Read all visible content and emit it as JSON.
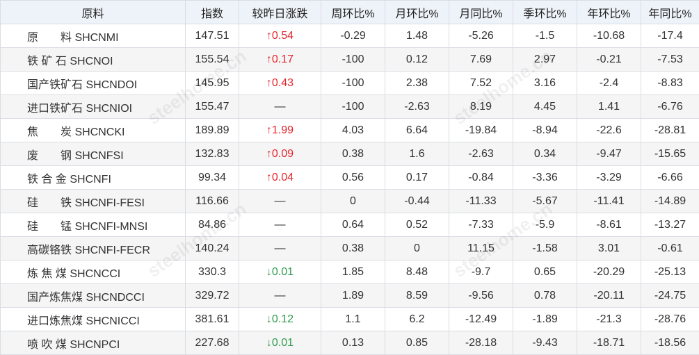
{
  "table": {
    "headers": [
      "原料",
      "指数",
      "较昨日涨跌",
      "周环比%",
      "月环比%",
      "月同比%",
      "季环比%",
      "年环比%",
      "年同比%"
    ],
    "rows": [
      {
        "name": "原　　料 SHCNMI",
        "index": "147.51",
        "change": "↑0.54",
        "dir": "up",
        "wow": "-0.29",
        "mom": "1.48",
        "yoy_m": "-5.26",
        "qoq": "-1.5",
        "y_env": "-10.68",
        "yoy": "-17.4"
      },
      {
        "name": "铁 矿 石 SHCNOI",
        "index": "155.54",
        "change": "↑0.17",
        "dir": "up",
        "wow": "-100",
        "mom": "0.12",
        "yoy_m": "7.69",
        "qoq": "2.97",
        "y_env": "-0.21",
        "yoy": "-7.53"
      },
      {
        "name": "国产铁矿石 SHCNDOI",
        "index": "145.95",
        "change": "↑0.43",
        "dir": "up",
        "wow": "-100",
        "mom": "2.38",
        "yoy_m": "7.52",
        "qoq": "3.16",
        "y_env": "-2.4",
        "yoy": "-8.83"
      },
      {
        "name": "进口铁矿石 SHCNIOI",
        "index": "155.47",
        "change": "—",
        "dir": "flat",
        "wow": "-100",
        "mom": "-2.63",
        "yoy_m": "8.19",
        "qoq": "4.45",
        "y_env": "1.41",
        "yoy": "-6.76"
      },
      {
        "name": "焦　　炭 SHCNCKI",
        "index": "189.89",
        "change": "↑1.99",
        "dir": "up",
        "wow": "4.03",
        "mom": "6.64",
        "yoy_m": "-19.84",
        "qoq": "-8.94",
        "y_env": "-22.6",
        "yoy": "-28.81"
      },
      {
        "name": "废　　钢 SHCNFSI",
        "index": "132.83",
        "change": "↑0.09",
        "dir": "up",
        "wow": "0.38",
        "mom": "1.6",
        "yoy_m": "-2.63",
        "qoq": "0.34",
        "y_env": "-9.47",
        "yoy": "-15.65"
      },
      {
        "name": "铁 合 金 SHCNFI",
        "index": "99.34",
        "change": "↑0.04",
        "dir": "up",
        "wow": "0.56",
        "mom": "0.17",
        "yoy_m": "-0.84",
        "qoq": "-3.36",
        "y_env": "-3.29",
        "yoy": "-6.66"
      },
      {
        "name": "硅　　铁 SHCNFI-FESI",
        "index": "116.66",
        "change": "—",
        "dir": "flat",
        "wow": "0",
        "mom": "-0.44",
        "yoy_m": "-11.33",
        "qoq": "-5.67",
        "y_env": "-11.41",
        "yoy": "-14.89"
      },
      {
        "name": "硅　　锰 SHCNFI-MNSI",
        "index": "84.86",
        "change": "—",
        "dir": "flat",
        "wow": "0.64",
        "mom": "0.52",
        "yoy_m": "-7.33",
        "qoq": "-5.9",
        "y_env": "-8.61",
        "yoy": "-13.27"
      },
      {
        "name": "高碳铬铁 SHCNFI-FECR",
        "index": "140.24",
        "change": "—",
        "dir": "flat",
        "wow": "0.38",
        "mom": "0",
        "yoy_m": "11.15",
        "qoq": "-1.58",
        "y_env": "3.01",
        "yoy": "-0.61"
      },
      {
        "name": "炼 焦 煤 SHCNCCI",
        "index": "330.3",
        "change": "↓0.01",
        "dir": "down",
        "wow": "1.85",
        "mom": "8.48",
        "yoy_m": "-9.7",
        "qoq": "0.65",
        "y_env": "-20.29",
        "yoy": "-25.13"
      },
      {
        "name": "国产炼焦煤 SHCNDCCI",
        "index": "329.72",
        "change": "—",
        "dir": "flat",
        "wow": "1.89",
        "mom": "8.59",
        "yoy_m": "-9.56",
        "qoq": "0.78",
        "y_env": "-20.11",
        "yoy": "-24.75"
      },
      {
        "name": "进口炼焦煤 SHCNICCI",
        "index": "381.61",
        "change": "↓0.12",
        "dir": "down",
        "wow": "1.1",
        "mom": "6.2",
        "yoy_m": "-12.49",
        "qoq": "-1.89",
        "y_env": "-21.3",
        "yoy": "-28.76"
      },
      {
        "name": "喷 吹 煤 SHCNPCI",
        "index": "227.68",
        "change": "↓0.01",
        "dir": "down",
        "wow": "0.13",
        "mom": "0.85",
        "yoy_m": "-28.18",
        "qoq": "-9.43",
        "y_env": "-18.71",
        "yoy": "-18.56"
      }
    ]
  },
  "watermark": "steelhome.cn"
}
